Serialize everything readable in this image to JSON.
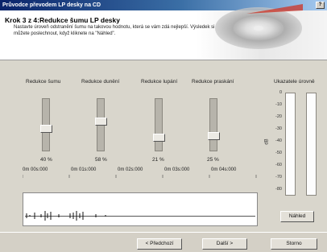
{
  "window": {
    "title": "Průvodce převodem LP desky na CD",
    "help_label": "?"
  },
  "header": {
    "step_title": "Krok 3 z 4:Redukce šumu LP desky",
    "step_desc": "Nastavte úroveň odstranění šumu na takovou hodnotu, která se vám zdá nejlepší. Výsledek si můžete poslechnout, když kliknete na \"Náhled\"."
  },
  "sliders": [
    {
      "label": "Redukce šumu",
      "value": "40 %",
      "level": 0.4
    },
    {
      "label": "Redukce dunění",
      "value": "58 %",
      "level": 0.58
    },
    {
      "label": "Redukce lupání",
      "value": "21 %",
      "level": 0.21
    },
    {
      "label": "Redukce praskání",
      "value": "25 %",
      "level": 0.25
    }
  ],
  "timeline": {
    "ticks": [
      "0m 00s:000",
      "0m 01s:000",
      "0m 02s:000",
      "0m 03s:000",
      "0m 04s:000"
    ]
  },
  "meter": {
    "label": "Ukazatele úrovně",
    "unit": "dB",
    "ticks": [
      "0",
      "-10",
      "-20",
      "-30",
      "-40",
      "-50",
      "-60",
      "-70",
      "-80"
    ],
    "left_level": 0.0,
    "right_level": 0.0
  },
  "buttons": {
    "preview": "Náhled",
    "back": "< Předchozí",
    "next": "Další >",
    "cancel": "Storno"
  }
}
